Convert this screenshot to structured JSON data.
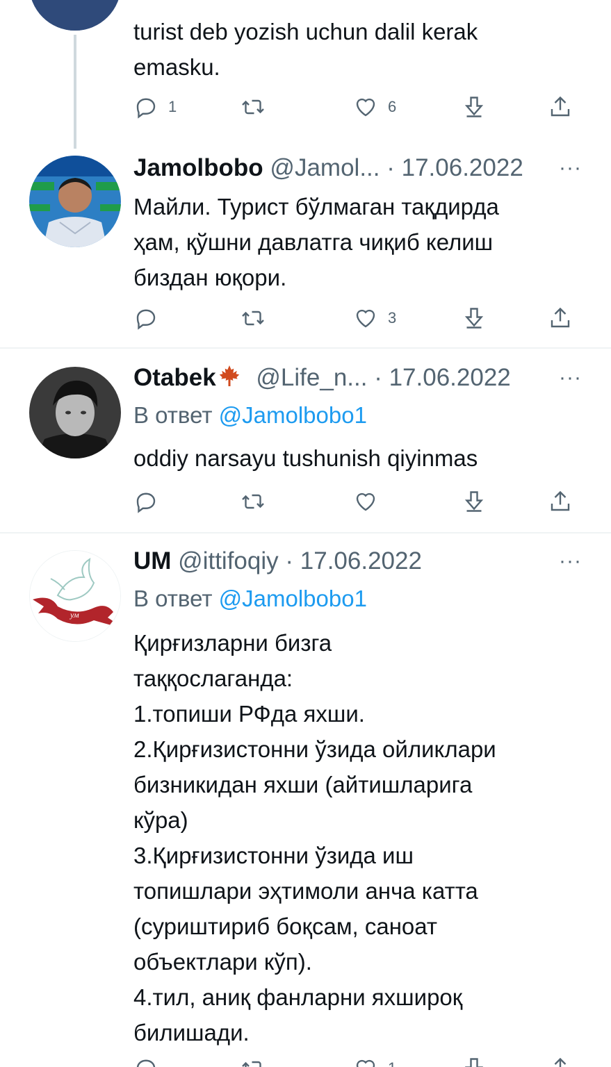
{
  "tweets": [
    {
      "body": "turist deb yozish uchun dalil kerak\nemasku.",
      "reply_count": "1",
      "retweet_count": "",
      "like_count": "6"
    },
    {
      "name": "Jamolbobo",
      "handle": "@Jamol...",
      "dot": "·",
      "date": "17.06.2022",
      "body": "Майли. Турист бўлмаган тақдирда\nҳам, қўшни давлатга чиқиб келиш\nбиздан юқори.",
      "reply_count": "",
      "retweet_count": "",
      "like_count": "3"
    },
    {
      "name": "Otabek",
      "handle": "@Life_n...",
      "dot": "·",
      "date": "17.06.2022",
      "reply_prefix": "В ответ",
      "reply_mention": "@Jamolbobo1",
      "body": "oddiy narsayu tushunish qiyinmas",
      "reply_count": "",
      "retweet_count": "",
      "like_count": ""
    },
    {
      "name": "UM",
      "handle": "@ittifoqiy",
      "dot": "·",
      "date": "17.06.2022",
      "reply_prefix": "В ответ",
      "reply_mention": "@Jamolbobo1",
      "avatar_text": "ум",
      "body": "Қирғизларни бизга\nтаққослаганда:\n1.топиши РФда яхши.\n2.Қирғизистонни ўзида ойликлари\nбизникидан яхши (айтишларига\nкўра)\n3.Қирғизистонни ўзида иш\nтопишлари эҳтимоли анча катта\n(суриштириб боқсам, саноат\nобъектлари кўп).\n4.тил, аниқ фанларни яхшироқ\nбилишади.",
      "reply_count": "",
      "retweet_count": "",
      "like_count": "1"
    }
  ],
  "icons": {
    "reply": "reply-icon",
    "retweet": "retweet-icon",
    "like": "like-icon",
    "share": "share-icon",
    "upload": "upload-icon",
    "more": "more-icon"
  },
  "more_glyph": "···",
  "colors": {
    "text": "#0f1419",
    "secondary": "#536471",
    "link": "#1d9bf0",
    "divider": "#eff3f4",
    "maple": "#d14a1e",
    "ribbon": "#b2252b"
  }
}
